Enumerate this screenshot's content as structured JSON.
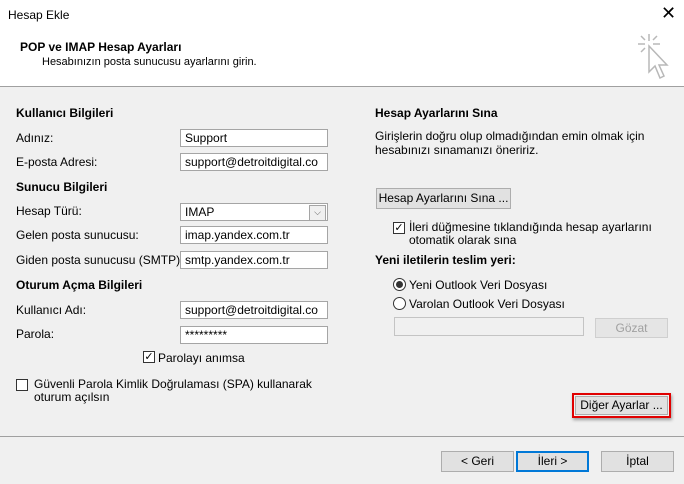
{
  "window": {
    "title": "Hesap Ekle",
    "close_icon": "close-icon"
  },
  "header": {
    "title": "POP ve IMAP Hesap Ayarları",
    "subtitle": "Hesabınızın posta sunucusu ayarlarını girin.",
    "icon": "cursor-click-icon"
  },
  "left": {
    "user_section": "Kullanıcı Bilgileri",
    "name_label": "Adınız:",
    "name_value": "Support",
    "email_label": "E-posta Adresi:",
    "email_value": "support@detroitdigital.co",
    "server_section": "Sunucu Bilgileri",
    "account_type_label": "Hesap Türü:",
    "account_type_value": "IMAP",
    "incoming_label": "Gelen posta sunucusu:",
    "incoming_value": "imap.yandex.com.tr",
    "outgoing_label": "Giden posta sunucusu (SMTP):",
    "outgoing_value": "smtp.yandex.com.tr",
    "logon_section": "Oturum Açma Bilgileri",
    "username_label": "Kullanıcı Adı:",
    "username_value": "support@detroitdigital.co",
    "password_label": "Parola:",
    "password_value": "*********",
    "remember_label": "Parolayı anımsa",
    "remember_checked": true,
    "spa_label": "Güvenli Parola Kimlik Doğrulaması (SPA) kullanarak oturum açılsın",
    "spa_checked": false
  },
  "right": {
    "test_section": "Hesap Ayarlarını Sına",
    "test_desc": "Girişlerin doğru olup olmadığından emin olmak için hesabınızı sınamanızı öneririz.",
    "test_button": "Hesap Ayarlarını Sına ...",
    "auto_test_label": "İleri düğmesine tıklandığında hesap ayarlarını otomatik olarak sına",
    "auto_test_checked": true,
    "delivery_section": "Yeni iletilerin teslim yeri:",
    "new_file_label": "Yeni Outlook Veri Dosyası",
    "existing_file_label": "Varolan Outlook Veri Dosyası",
    "selected_delivery": "Yeni Outlook Veri Dosyası",
    "file_path_value": "",
    "browse_button": "Gözat",
    "more_settings_button": "Diğer Ayarlar ...",
    "highlight_color": "#e00000"
  },
  "footer": {
    "back": "< Geri",
    "next": "İleri >",
    "cancel": "İptal"
  }
}
